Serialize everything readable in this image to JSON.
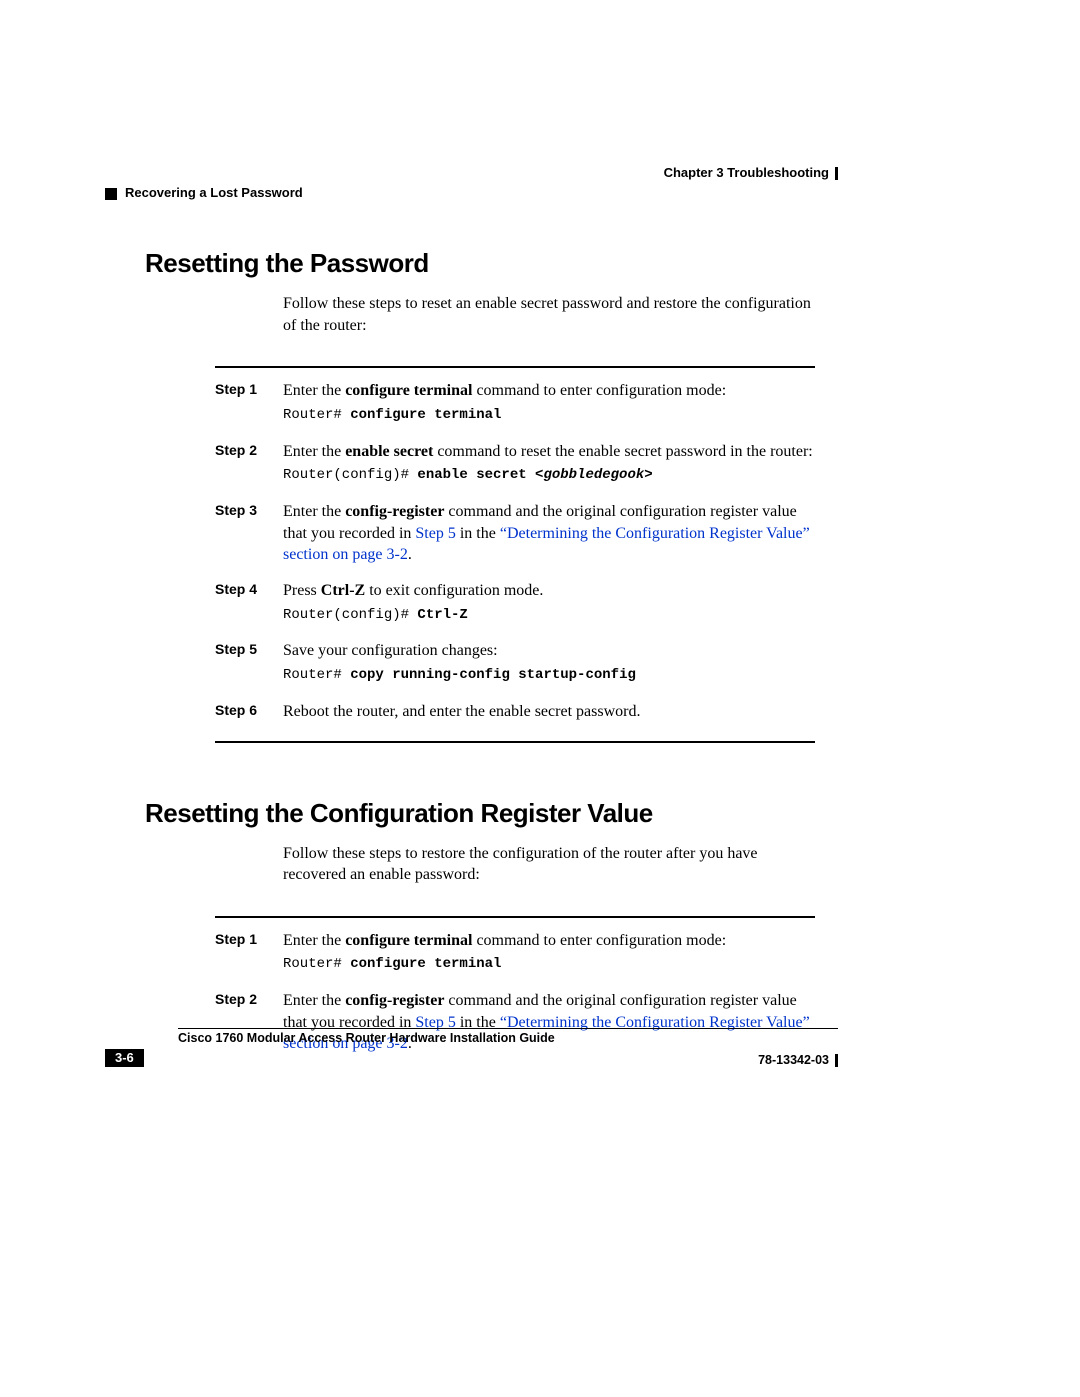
{
  "header": {
    "chapter": "Chapter 3    Troubleshooting",
    "subheader": "Recovering a Lost Password"
  },
  "section1": {
    "title": "Resetting the Password",
    "intro": "Follow these steps to reset an enable secret password and restore the configuration of the router:",
    "steps": {
      "s1": {
        "label": "Step 1",
        "text_a": "Enter the ",
        "bold1": "configure terminal",
        "text_b": " command to enter configuration mode:",
        "code_plain": "Router# ",
        "code_bold": "configure terminal"
      },
      "s2": {
        "label": "Step 2",
        "text_a": "Enter the ",
        "bold1": "enable secret",
        "text_b": " command to reset the enable secret password in the router:",
        "code_plain": "Router(config)# ",
        "code_bold": "enable secret ",
        "code_italic": "<gobbledegook>"
      },
      "s3": {
        "label": "Step 3",
        "text_a": "Enter the ",
        "bold1": "config-register",
        "text_b": " command and the original configuration register value that you recorded in ",
        "link1": "Step 5",
        "text_c": " in the ",
        "link2": "“Determining the Configuration Register Value” section on page 3-2",
        "text_d": "."
      },
      "s4": {
        "label": "Step 4",
        "text_a": "Press ",
        "bold1": "Ctrl-Z",
        "text_b": " to exit configuration mode.",
        "code_plain": "Router(config)# ",
        "code_bold": "Ctrl-Z"
      },
      "s5": {
        "label": "Step 5",
        "text_a": "Save your configuration changes:",
        "code_plain": "Router# ",
        "code_bold": "copy running-config startup-config"
      },
      "s6": {
        "label": "Step 6",
        "text_a": "Reboot the router, and enter the enable secret password."
      }
    }
  },
  "section2": {
    "title": "Resetting the Configuration Register Value",
    "intro": "Follow these steps to restore the configuration of the router after you have recovered an enable password:",
    "steps": {
      "s1": {
        "label": "Step 1",
        "text_a": "Enter the ",
        "bold1": "configure terminal",
        "text_b": " command to enter configuration mode:",
        "code_plain": "Router# ",
        "code_bold": "configure terminal"
      },
      "s2": {
        "label": "Step 2",
        "text_a": "Enter the ",
        "bold1": "config-register",
        "text_b": " command and the original configuration register value that you recorded in ",
        "link1": "Step 5",
        "text_c": " in the ",
        "link2": "“Determining the Configuration Register Value” section on page 3-2",
        "text_d": "."
      }
    }
  },
  "footer": {
    "guide": "Cisco 1760 Modular Access Router Hardware Installation Guide",
    "page": "3-6",
    "docnum": "78-13342-03"
  }
}
